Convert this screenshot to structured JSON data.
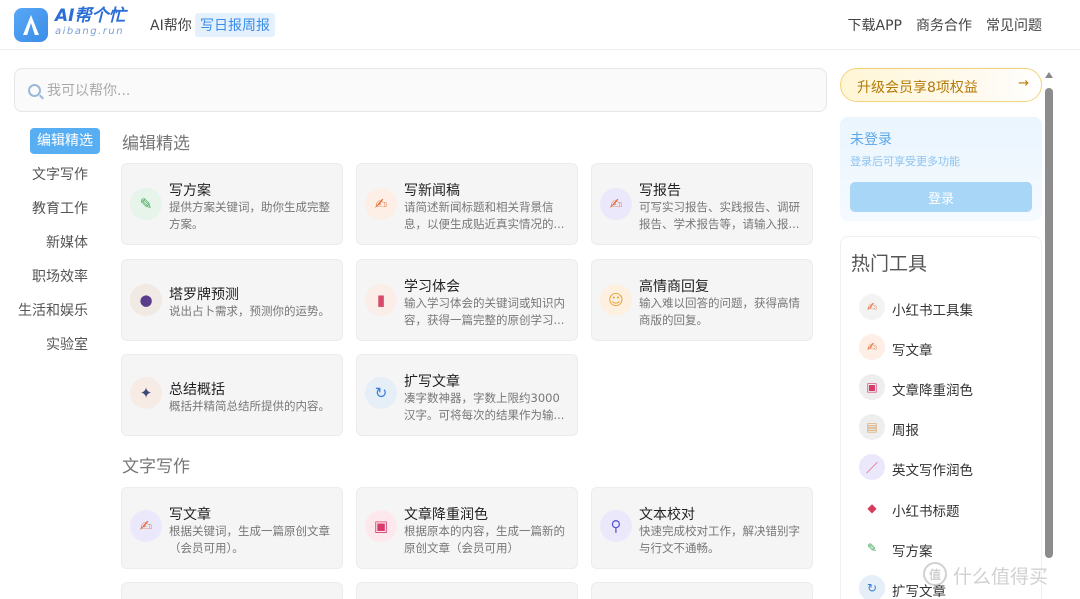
{
  "header": {
    "brand_main": "AI帮个忙",
    "brand_sub": "aibang.run",
    "nav_home": "AI帮你",
    "nav_active": "写日报周报",
    "links": [
      "下载APP",
      "商务合作",
      "常见问题"
    ]
  },
  "search": {
    "placeholder": "我可以帮你..."
  },
  "sidenav": {
    "items": [
      "编辑精选",
      "文字写作",
      "教育工作",
      "新媒体",
      "职场效率",
      "生活和娱乐",
      "实验室"
    ],
    "active_index": 0
  },
  "sections": [
    {
      "title": "编辑精选",
      "cards": [
        {
          "title": "写方案",
          "desc": "提供方案关键词，助你生成完整方案。",
          "icon": "document-icon"
        },
        {
          "title": "写新闻稿",
          "desc": "请简述新闻标题和相关背景信息，以便生成贴近真实情况的...",
          "icon": "pencil-icon"
        },
        {
          "title": "写报告",
          "desc": "可写实习报告、实践报告、调研报告、学术报告等，请输入报...",
          "icon": "pencil-icon"
        },
        {
          "title": "塔罗牌预测",
          "desc": "说出占卜需求，预测你的运势。",
          "icon": "crystal-ball-icon"
        },
        {
          "title": "学习体会",
          "desc": "输入学习体会的关键词或知识内容，获得一篇完整的原创学习...",
          "icon": "books-icon"
        },
        {
          "title": "高情商回复",
          "desc": "输入难以回答的问题，获得高情商版的回复。",
          "icon": "smile-icon"
        },
        {
          "title": "总结概括",
          "desc": "概括并精简总结所提供的内容。",
          "icon": "telescope-icon"
        },
        {
          "title": "扩写文章",
          "desc": "凑字数神器，字数上限约3000汉字。可将每次的结果作为输...",
          "icon": "refresh-icon"
        }
      ]
    },
    {
      "title": "文字写作",
      "cards": [
        {
          "title": "写文章",
          "desc": "根据关键词，生成一篇原创文章（会员可用）。",
          "icon": "pencil-icon"
        },
        {
          "title": "文章降重润色",
          "desc": "根据原本的内容，生成一篇新的原创文章（会员可用）",
          "icon": "stamp-icon"
        },
        {
          "title": "文本校对",
          "desc": "快速完成校对工作，解决错别字与行文不通畅。",
          "icon": "magnifier-icon"
        }
      ]
    }
  ],
  "upgrade": {
    "label": "升级会员享8项权益",
    "arrow": "→"
  },
  "login": {
    "title": "未登录",
    "subtitle": "登录后可享受更多功能",
    "button": "登录"
  },
  "hot_tools": {
    "title": "热门工具",
    "items": [
      {
        "label": "小红书工具集",
        "icon": "pencil-icon"
      },
      {
        "label": "写文章",
        "icon": "pencil-icon"
      },
      {
        "label": "文章降重润色",
        "icon": "stamp-icon"
      },
      {
        "label": "周报",
        "icon": "scroll-icon"
      },
      {
        "label": "英文写作润色",
        "icon": "pen-icon"
      },
      {
        "label": "小红书标题",
        "icon": "tag-icon"
      },
      {
        "label": "写方案",
        "icon": "document-icon"
      },
      {
        "label": "扩写文章",
        "icon": "refresh-icon"
      }
    ]
  },
  "watermark": {
    "badge": "值",
    "text": "什么值得买"
  }
}
